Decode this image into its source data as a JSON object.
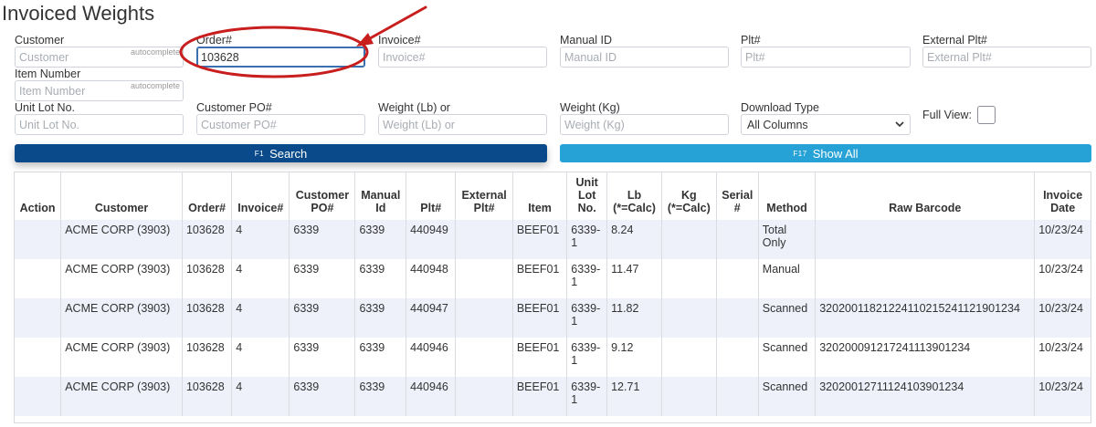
{
  "title": "Invoiced Weights",
  "filters": {
    "customer": {
      "label": "Customer",
      "placeholder": "Customer",
      "hint": "autocomplete"
    },
    "order": {
      "label": "Order#",
      "value": "103628"
    },
    "invoice": {
      "label": "Invoice#",
      "placeholder": "Invoice#"
    },
    "manual_id": {
      "label": "Manual ID",
      "placeholder": "Manual ID"
    },
    "plt": {
      "label": "Plt#",
      "placeholder": "Plt#"
    },
    "external_plt": {
      "label": "External Plt#",
      "placeholder": "External Plt#"
    },
    "item_number": {
      "label": "Item Number",
      "placeholder": "Item Number",
      "hint": "autocomplete"
    },
    "unit_lot": {
      "label": "Unit Lot No.",
      "placeholder": "Unit Lot No."
    },
    "customer_po": {
      "label": "Customer PO#",
      "placeholder": "Customer PO#"
    },
    "weight_lb": {
      "label": "Weight (Lb) or",
      "placeholder": "Weight (Lb) or"
    },
    "weight_kg": {
      "label": "Weight (Kg)",
      "placeholder": "Weight (Kg)"
    },
    "download_type": {
      "label": "Download Type",
      "selected": "All Columns"
    },
    "full_view": {
      "label": "Full View:"
    }
  },
  "buttons": {
    "search": {
      "fkey": "F1",
      "label": "Search"
    },
    "show_all": {
      "fkey": "F17",
      "label": "Show All"
    }
  },
  "table": {
    "columns": [
      {
        "l1": "",
        "l2": "",
        "l3": "Action"
      },
      {
        "l1": "",
        "l2": "",
        "l3": "Customer"
      },
      {
        "l1": "",
        "l2": "",
        "l3": "Order#"
      },
      {
        "l1": "",
        "l2": "",
        "l3": "Invoice#"
      },
      {
        "l1": "",
        "l2": "Customer",
        "l3": "PO#"
      },
      {
        "l1": "",
        "l2": "Manual",
        "l3": "Id"
      },
      {
        "l1": "",
        "l2": "",
        "l3": "Plt#"
      },
      {
        "l1": "",
        "l2": "External",
        "l3": "Plt#"
      },
      {
        "l1": "",
        "l2": "",
        "l3": "Item"
      },
      {
        "l1": "Unit",
        "l2": "Lot",
        "l3": "No."
      },
      {
        "l1": "",
        "l2": "Lb",
        "l3": "(*=Calc)"
      },
      {
        "l1": "",
        "l2": "Kg",
        "l3": "(*=Calc)"
      },
      {
        "l1": "",
        "l2": "Serial",
        "l3": "#"
      },
      {
        "l1": "",
        "l2": "",
        "l3": "Method"
      },
      {
        "l1": "",
        "l2": "",
        "l3": "Raw Barcode"
      },
      {
        "l1": "",
        "l2": "Invoice",
        "l3": "Date"
      }
    ],
    "rows": [
      {
        "action": "",
        "customer": "ACME CORP (3903)",
        "order": "103628",
        "invoice": "4",
        "customer_po": "6339",
        "manual_id": "6339",
        "plt": "440949",
        "external_plt": "",
        "item": "BEEF01",
        "lot_1": "6339-",
        "lot_2": "1",
        "lb": "8.24",
        "kg": "",
        "serial": "",
        "method_1": "Total",
        "method_2": "Only",
        "raw_barcode": "",
        "invoice_date": "10/23/24"
      },
      {
        "action": "",
        "customer": "ACME CORP (3903)",
        "order": "103628",
        "invoice": "4",
        "customer_po": "6339",
        "manual_id": "6339",
        "plt": "440948",
        "external_plt": "",
        "item": "BEEF01",
        "lot_1": "6339-",
        "lot_2": "1",
        "lb": "11.47",
        "kg": "",
        "serial": "",
        "method_1": "Manual",
        "method_2": "",
        "raw_barcode": "",
        "invoice_date": "10/23/24"
      },
      {
        "action": "",
        "customer": "ACME CORP (3903)",
        "order": "103628",
        "invoice": "4",
        "customer_po": "6339",
        "manual_id": "6339",
        "plt": "440947",
        "external_plt": "",
        "item": "BEEF01",
        "lot_1": "6339-",
        "lot_2": "1",
        "lb": "11.82",
        "kg": "",
        "serial": "",
        "method_1": "Scanned",
        "method_2": "",
        "raw_barcode": "3202001182122411021524112190123​4",
        "invoice_date": "10/23/24"
      },
      {
        "action": "",
        "customer": "ACME CORP (3903)",
        "order": "103628",
        "invoice": "4",
        "customer_po": "6339",
        "manual_id": "6339",
        "plt": "440946",
        "external_plt": "",
        "item": "BEEF01",
        "lot_1": "6339-",
        "lot_2": "1",
        "lb": "9.12",
        "kg": "",
        "serial": "",
        "method_1": "Scanned",
        "method_2": "",
        "raw_barcode": "3202000912172411139​01234",
        "invoice_date": "10/23/24"
      },
      {
        "action": "",
        "customer": "ACME CORP (3903)",
        "order": "103628",
        "invoice": "4",
        "customer_po": "6339",
        "manual_id": "6339",
        "plt": "440946",
        "external_plt": "",
        "item": "BEEF01",
        "lot_1": "6339-",
        "lot_2": "1",
        "lb": "12.71",
        "kg": "",
        "serial": "",
        "method_1": "Scanned",
        "method_2": "",
        "raw_barcode": "320200127111241039​01234",
        "invoice_date": "10/23/24"
      }
    ]
  },
  "colors": {
    "search_button": "#0a4a8a",
    "show_all_button": "#27a2d6",
    "annotation": "#c81e1e",
    "row_stripe": "#eef0fa"
  }
}
